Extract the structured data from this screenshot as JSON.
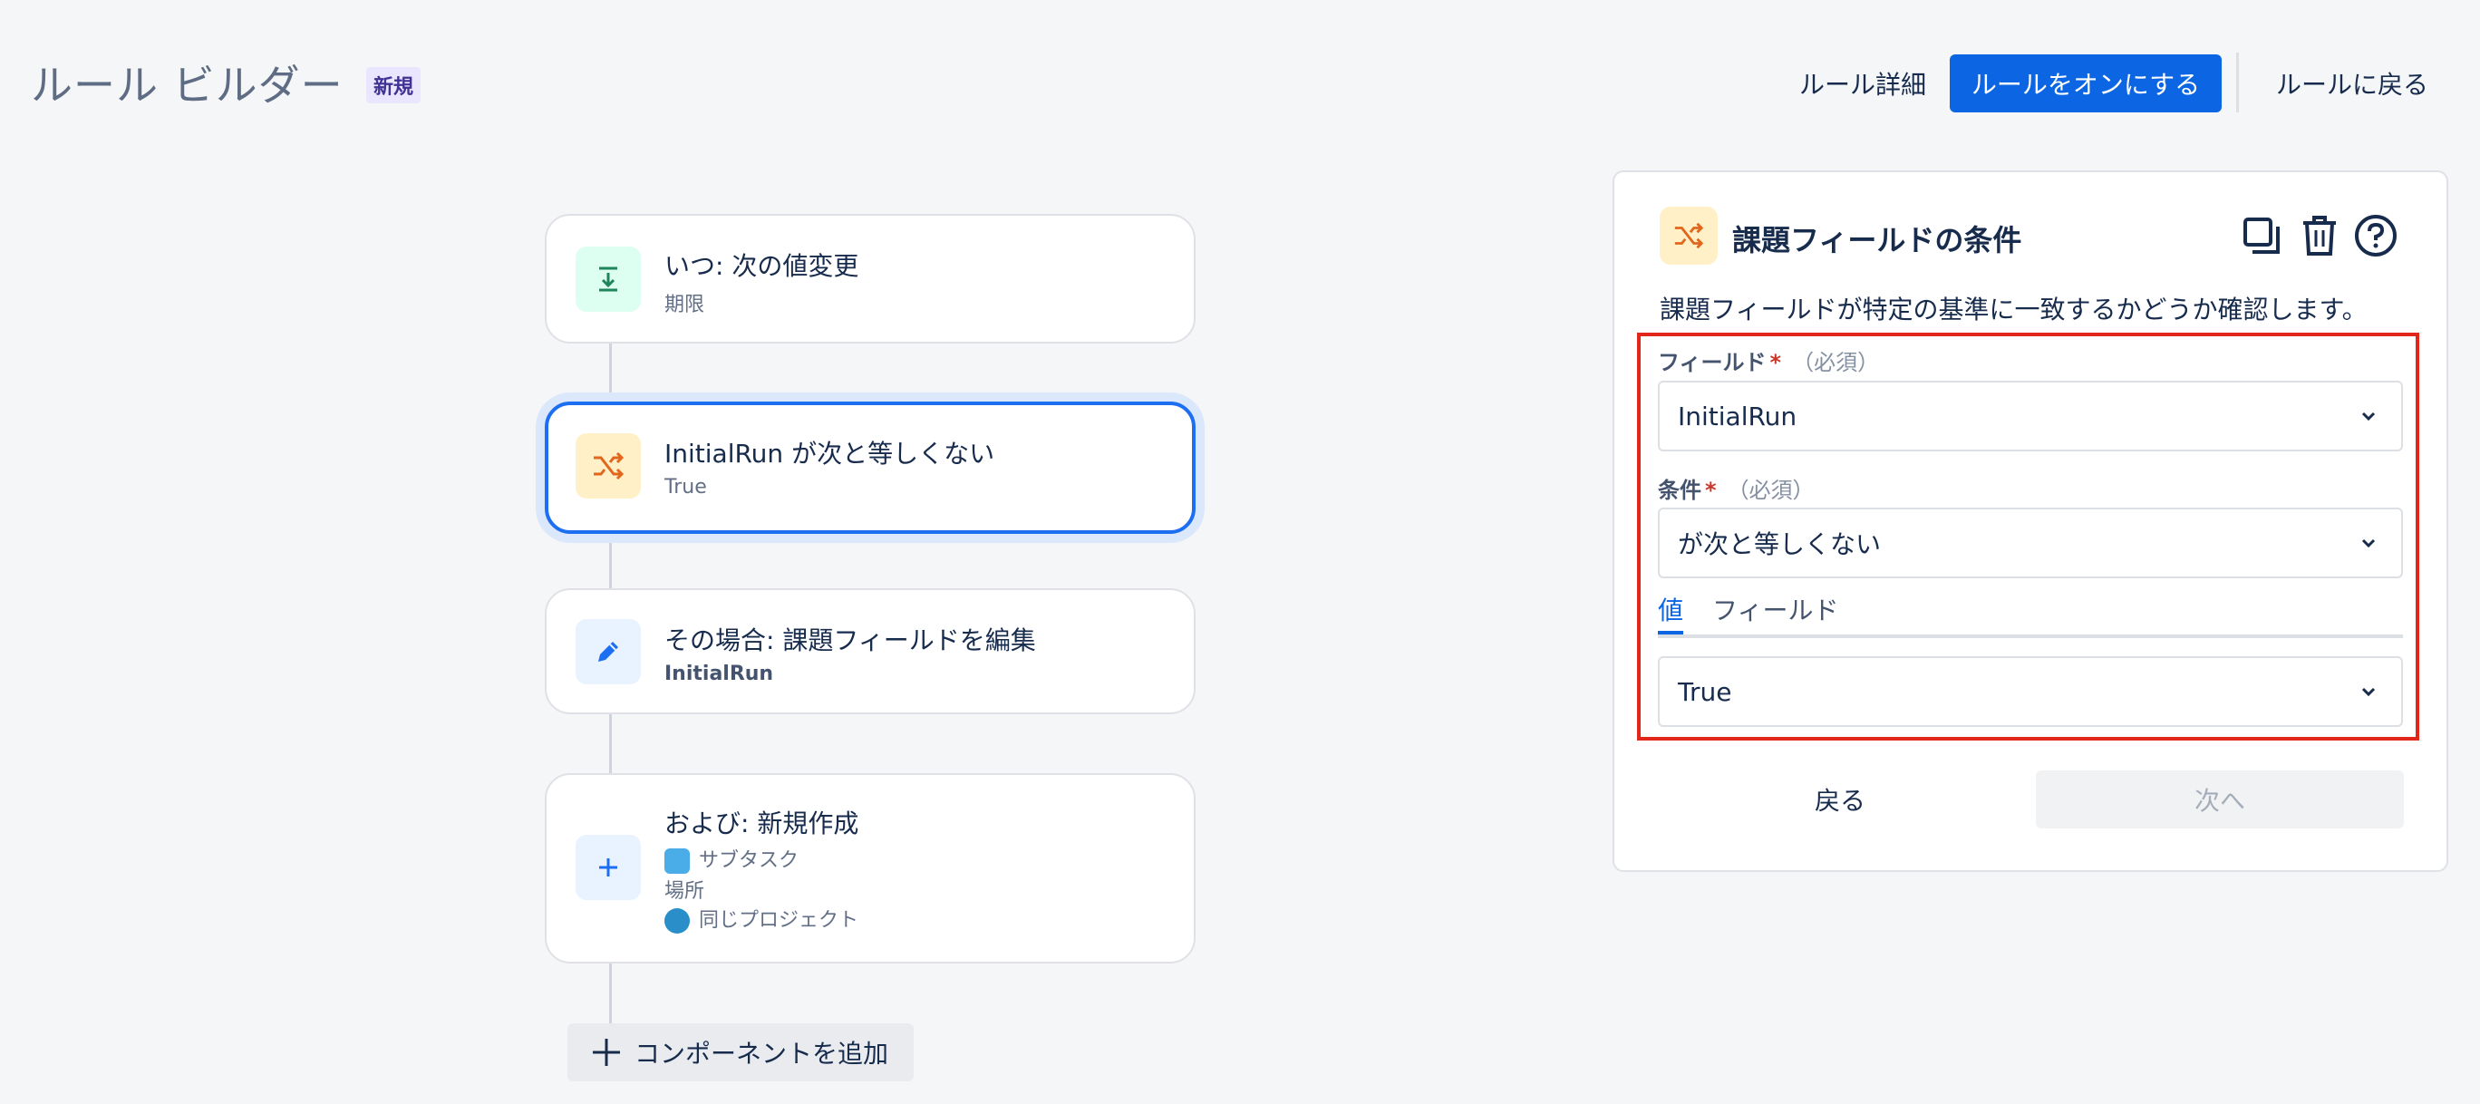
{
  "header": {
    "title": "ルール ビルダー",
    "badge": "新規",
    "rule_details": "ルール詳細",
    "turn_on": "ルールをオンにする",
    "back_to_rules": "ルールに戻る"
  },
  "flow": {
    "trigger": {
      "title": "いつ: 次の値変更",
      "subtitle": "期限",
      "icon": "download-arrow-icon"
    },
    "condition": {
      "title": "InitialRun が次と等しくない",
      "subtitle": "True",
      "icon": "shuffle-icon"
    },
    "action_edit": {
      "title": "その場合: 課題フィールドを編集",
      "subtitle": "InitialRun",
      "icon": "pencil-icon"
    },
    "action_create": {
      "title": "および: 新規作成",
      "line1": "サブタスク",
      "line2": "場所",
      "line3": "同じプロジェクト",
      "icon": "plus-icon"
    },
    "add_component": "コンポーネントを追加"
  },
  "panel": {
    "title": "課題フィールドの条件",
    "description": "課題フィールドが特定の基準に一致するかどうか確認します。",
    "field": {
      "label": "フィールド",
      "required_mark": "*",
      "required_note": "（必須）",
      "value": "InitialRun"
    },
    "condition": {
      "label": "条件",
      "required_mark": "*",
      "required_note": "（必須）",
      "value": "が次と等しくない"
    },
    "tabs": [
      {
        "label": "値",
        "active": true
      },
      {
        "label": "フィールド",
        "active": false
      }
    ],
    "value_select": "True",
    "back": "戻る",
    "next": "次へ"
  },
  "colors": {
    "primary": "#0c66e4",
    "highlight_border": "#e3261a",
    "selected_card": "#1d6ff2",
    "condition_icon_bg": "#fff0c7",
    "trigger_icon_bg": "#dcfff1"
  }
}
